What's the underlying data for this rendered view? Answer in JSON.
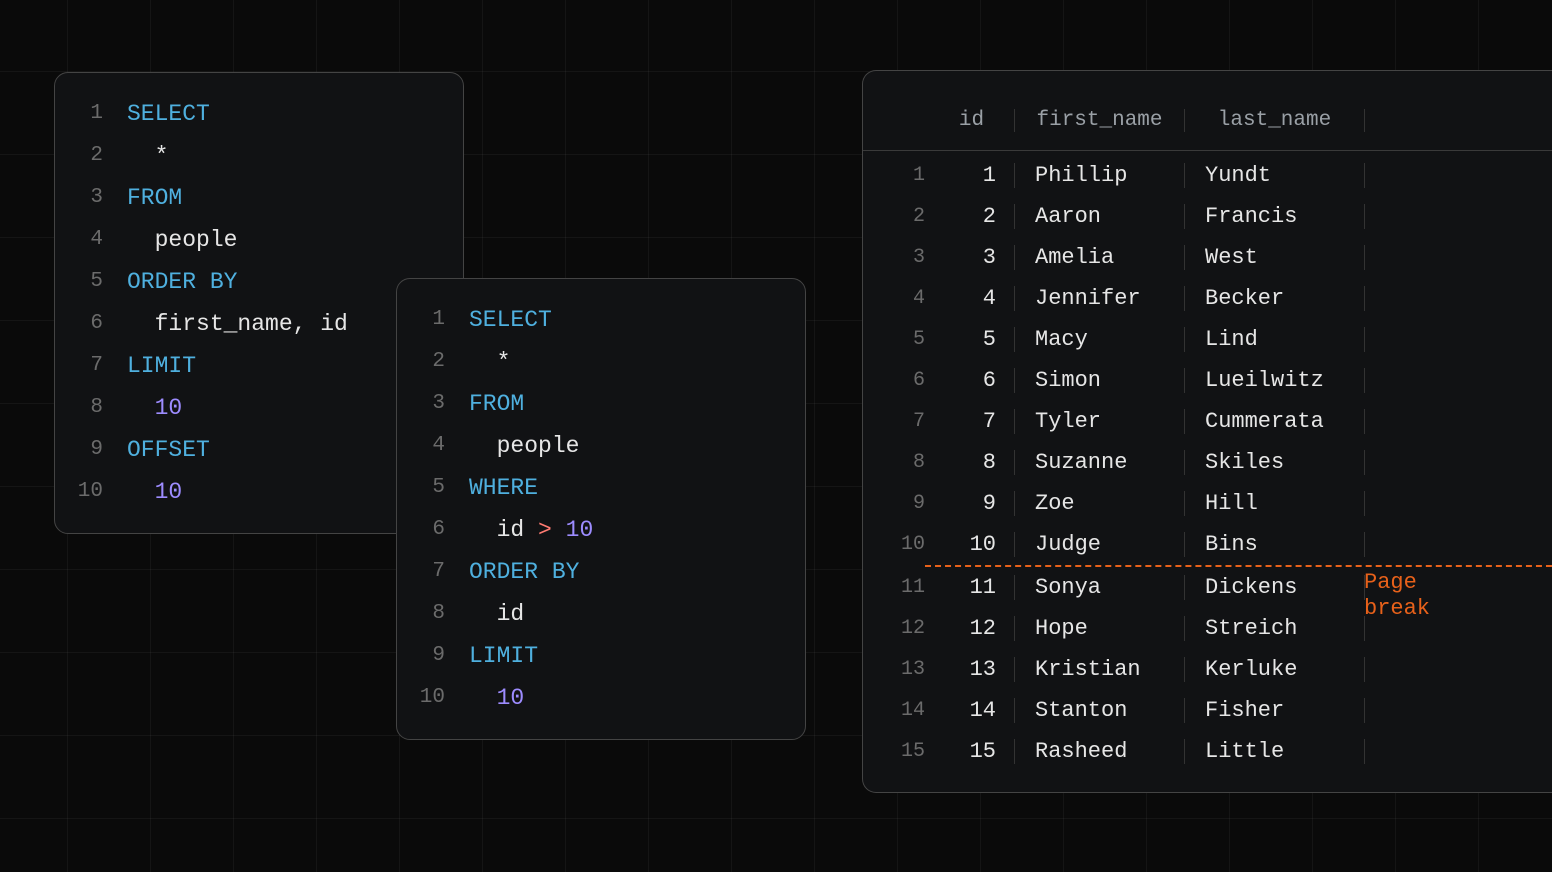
{
  "code_left": [
    [
      {
        "c": "kw",
        "t": "SELECT"
      }
    ],
    [
      {
        "c": "txt",
        "t": "  *"
      }
    ],
    [
      {
        "c": "kw",
        "t": "FROM"
      }
    ],
    [
      {
        "c": "txt",
        "t": "  people"
      }
    ],
    [
      {
        "c": "kw",
        "t": "ORDER BY"
      }
    ],
    [
      {
        "c": "txt",
        "t": "  first_name, id"
      }
    ],
    [
      {
        "c": "kw",
        "t": "LIMIT"
      }
    ],
    [
      {
        "c": "txt",
        "t": "  "
      },
      {
        "c": "num",
        "t": "10"
      }
    ],
    [
      {
        "c": "kw",
        "t": "OFFSET"
      }
    ],
    [
      {
        "c": "txt",
        "t": "  "
      },
      {
        "c": "num",
        "t": "10"
      }
    ]
  ],
  "code_mid": [
    [
      {
        "c": "kw",
        "t": "SELECT"
      }
    ],
    [
      {
        "c": "txt",
        "t": "  *"
      }
    ],
    [
      {
        "c": "kw",
        "t": "FROM"
      }
    ],
    [
      {
        "c": "txt",
        "t": "  people"
      }
    ],
    [
      {
        "c": "kw",
        "t": "WHERE"
      }
    ],
    [
      {
        "c": "txt",
        "t": "  id "
      },
      {
        "c": "op",
        "t": ">"
      },
      {
        "c": "txt",
        "t": " "
      },
      {
        "c": "num",
        "t": "10"
      }
    ],
    [
      {
        "c": "kw",
        "t": "ORDER BY"
      }
    ],
    [
      {
        "c": "txt",
        "t": "  id"
      }
    ],
    [
      {
        "c": "kw",
        "t": "LIMIT"
      }
    ],
    [
      {
        "c": "txt",
        "t": "  "
      },
      {
        "c": "num",
        "t": "10"
      }
    ]
  ],
  "table": {
    "headers": {
      "id": "id",
      "first_name": "first_name",
      "last_name": "last_name"
    },
    "rows": [
      {
        "id": "1",
        "first_name": "Phillip",
        "last_name": "Yundt"
      },
      {
        "id": "2",
        "first_name": "Aaron",
        "last_name": "Francis"
      },
      {
        "id": "3",
        "first_name": "Amelia",
        "last_name": "West"
      },
      {
        "id": "4",
        "first_name": "Jennifer",
        "last_name": "Becker"
      },
      {
        "id": "5",
        "first_name": "Macy",
        "last_name": "Lind"
      },
      {
        "id": "6",
        "first_name": "Simon",
        "last_name": "Lueilwitz"
      },
      {
        "id": "7",
        "first_name": "Tyler",
        "last_name": "Cummerata"
      },
      {
        "id": "8",
        "first_name": "Suzanne",
        "last_name": "Skiles"
      },
      {
        "id": "9",
        "first_name": "Zoe",
        "last_name": "Hill"
      },
      {
        "id": "10",
        "first_name": "Judge",
        "last_name": "Bins"
      },
      {
        "id": "11",
        "first_name": "Sonya",
        "last_name": "Dickens"
      },
      {
        "id": "12",
        "first_name": "Hope",
        "last_name": "Streich"
      },
      {
        "id": "13",
        "first_name": "Kristian",
        "last_name": "Kerluke"
      },
      {
        "id": "14",
        "first_name": "Stanton",
        "last_name": "Fisher"
      },
      {
        "id": "15",
        "first_name": "Rasheed",
        "last_name": "Little"
      }
    ],
    "page_break_after_index": 9
  },
  "labels": {
    "page_break": "Page\nbreak"
  }
}
